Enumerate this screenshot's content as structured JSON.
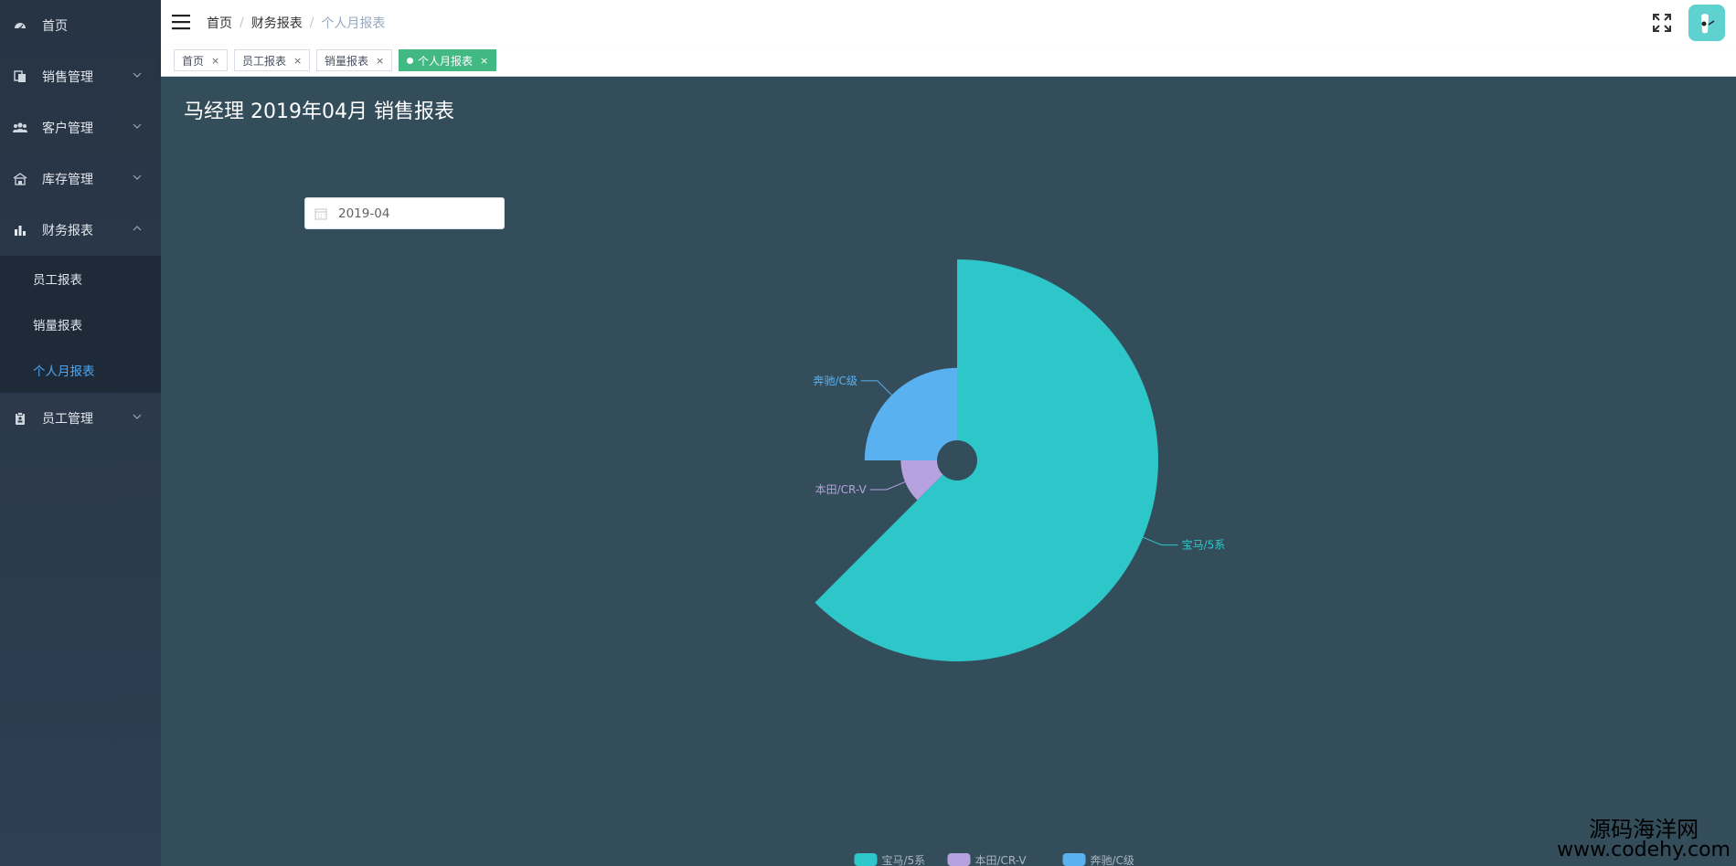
{
  "sidebar": {
    "items": [
      {
        "label": "首页",
        "icon": "dashboard-icon"
      },
      {
        "label": "销售管理",
        "icon": "document-icon"
      },
      {
        "label": "客户管理",
        "icon": "users-icon"
      },
      {
        "label": "库存管理",
        "icon": "warehouse-icon"
      },
      {
        "label": "财务报表",
        "icon": "bar-chart-icon"
      },
      {
        "label": "员工管理",
        "icon": "clipboard-icon"
      }
    ],
    "finance_sub": [
      "员工报表",
      "销量报表",
      "个人月报表"
    ]
  },
  "header": {
    "breadcrumb": [
      "首页",
      "财务报表",
      "个人月报表"
    ]
  },
  "tags": [
    {
      "label": "首页"
    },
    {
      "label": "员工报表"
    },
    {
      "label": "销量报表"
    },
    {
      "label": "个人月报表"
    }
  ],
  "main": {
    "title": "马经理 2019年04月 销售报表",
    "date_value": "2019-04"
  },
  "colors": {
    "background": "#344d5b",
    "accent": "#42b983",
    "active_link": "#4aa6f5"
  },
  "chart_data": {
    "type": "pie",
    "rose": true,
    "title": "",
    "categories": [
      "宝马/5系",
      "本田/CR-V",
      "奔驰/C级"
    ],
    "values": [
      5,
      1,
      2
    ],
    "colors": [
      "#2ec7c9",
      "#b6a2de",
      "#5ab1ef"
    ],
    "legend": "bottom-center"
  },
  "watermark": {
    "line1": "源码海洋网",
    "line2": "www.codehy.com"
  }
}
